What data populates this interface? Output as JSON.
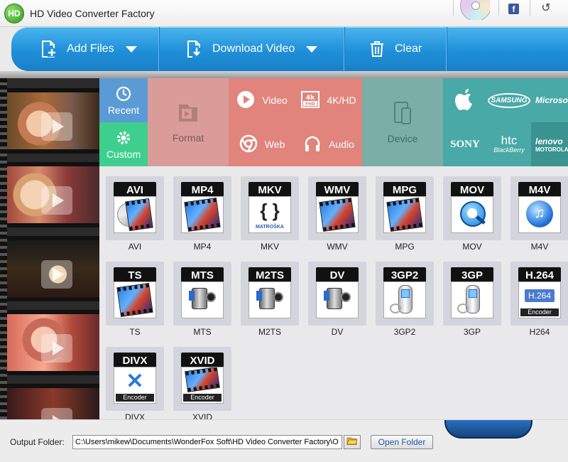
{
  "window": {
    "title": "HD Video Converter Factory",
    "logo_text": "HD"
  },
  "toolbar": {
    "add_files": "Add Files",
    "download_video": "Download Video",
    "clear": "Clear"
  },
  "categories": {
    "recent": "Recent",
    "custom": "Custom",
    "format": "Format",
    "video": "Video",
    "hd": "4K/HD",
    "web": "Web",
    "audio": "Audio",
    "device": "Device"
  },
  "brands": {
    "samsung": "SAMSUNG",
    "microsoft": "Microsoft",
    "sony": "SONY",
    "htc": "htc",
    "blackberry": "BlackBerry",
    "lenovo": "lenovo",
    "motorola": "MOTOROLA"
  },
  "formats": [
    {
      "badge": "AVI",
      "label": "AVI",
      "art": "film-disc"
    },
    {
      "badge": "MP4",
      "label": "MP4",
      "art": "film"
    },
    {
      "badge": "MKV",
      "label": "MKV",
      "art": "matroska"
    },
    {
      "badge": "WMV",
      "label": "WMV",
      "art": "film"
    },
    {
      "badge": "MPG",
      "label": "MPG",
      "art": "film"
    },
    {
      "badge": "MOV",
      "label": "MOV",
      "art": "quicktime"
    },
    {
      "badge": "M4V",
      "label": "M4V",
      "art": "itunes"
    },
    {
      "badge": "TS",
      "label": "TS",
      "art": "film"
    },
    {
      "badge": "MTS",
      "label": "MTS",
      "art": "camcorder"
    },
    {
      "badge": "M2TS",
      "label": "M2TS",
      "art": "camcorder"
    },
    {
      "badge": "DV",
      "label": "DV",
      "art": "camcorder"
    },
    {
      "badge": "3GP2",
      "label": "3GP2",
      "art": "phone"
    },
    {
      "badge": "3GP",
      "label": "3GP",
      "art": "phone"
    },
    {
      "badge": "H.264",
      "label": "H264",
      "art": "encoder-h264"
    },
    {
      "badge": "DIVX",
      "label": "DIVX",
      "art": "encoder-divx"
    },
    {
      "badge": "XVID",
      "label": "XVID",
      "art": "encoder-xvid"
    }
  ],
  "art_text": {
    "matroska": "MATROŠKA",
    "encoder": "Encoder",
    "h264_mini": "H.264"
  },
  "output": {
    "label": "Output Folder:",
    "path": "C:\\Users\\mikew\\Documents\\WonderFox Soft\\HD Video Converter Factory\\O",
    "open_folder": "Open Folder"
  },
  "colors": {
    "recent": "#5b9bd5",
    "custom": "#3ecf8e",
    "format_bg": "#d99c98",
    "red_cell": "#e0847c",
    "device_bg": "#7aaea6",
    "teal_cell": "#48a9a6",
    "teal_dark": "#3a9390",
    "toolbar_blue": "#1f8fd8"
  }
}
